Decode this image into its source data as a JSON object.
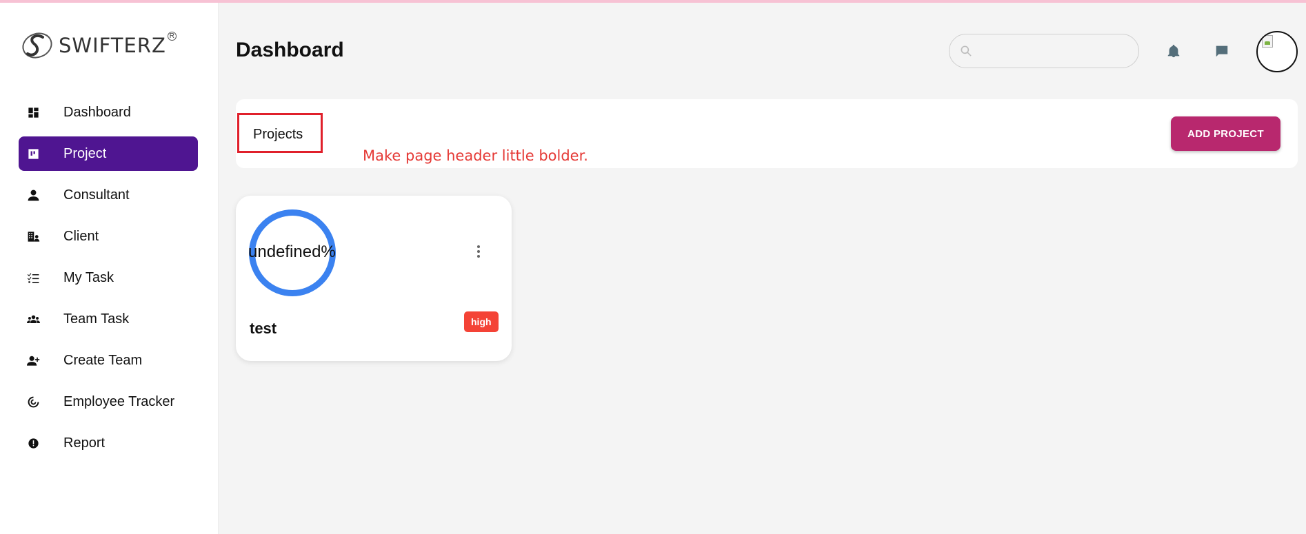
{
  "brand": {
    "name": "SWIFTERZ",
    "registered_mark": "R"
  },
  "sidebar": {
    "items": [
      {
        "label": "Dashboard",
        "icon": "dashboard-icon",
        "active": false
      },
      {
        "label": "Project",
        "icon": "project-icon",
        "active": true
      },
      {
        "label": "Consultant",
        "icon": "person-icon",
        "active": false
      },
      {
        "label": "Client",
        "icon": "client-building-icon",
        "active": false
      },
      {
        "label": "My Task",
        "icon": "task-list-icon",
        "active": false
      },
      {
        "label": "Team Task",
        "icon": "group-icon",
        "active": false
      },
      {
        "label": "Create Team",
        "icon": "person-add-icon",
        "active": false
      },
      {
        "label": "Employee Tracker",
        "icon": "tracker-icon",
        "active": false
      },
      {
        "label": "Report",
        "icon": "report-alert-icon",
        "active": false
      }
    ]
  },
  "header": {
    "title": "Dashboard",
    "search_placeholder": "",
    "notification_icon": "bell-icon",
    "message_icon": "chat-icon"
  },
  "projects_bar": {
    "label": "Projects",
    "annotation": "Make page header little bolder.",
    "add_button": "ADD PROJECT"
  },
  "projects": [
    {
      "title": "test",
      "progress_text": "undefined%",
      "priority": "high"
    }
  ],
  "colors": {
    "active_nav": "#4f1591",
    "add_button": "#b8286e",
    "progress_ring": "#3b82f0",
    "priority_high": "#f44336",
    "annotation": "#e53935"
  }
}
